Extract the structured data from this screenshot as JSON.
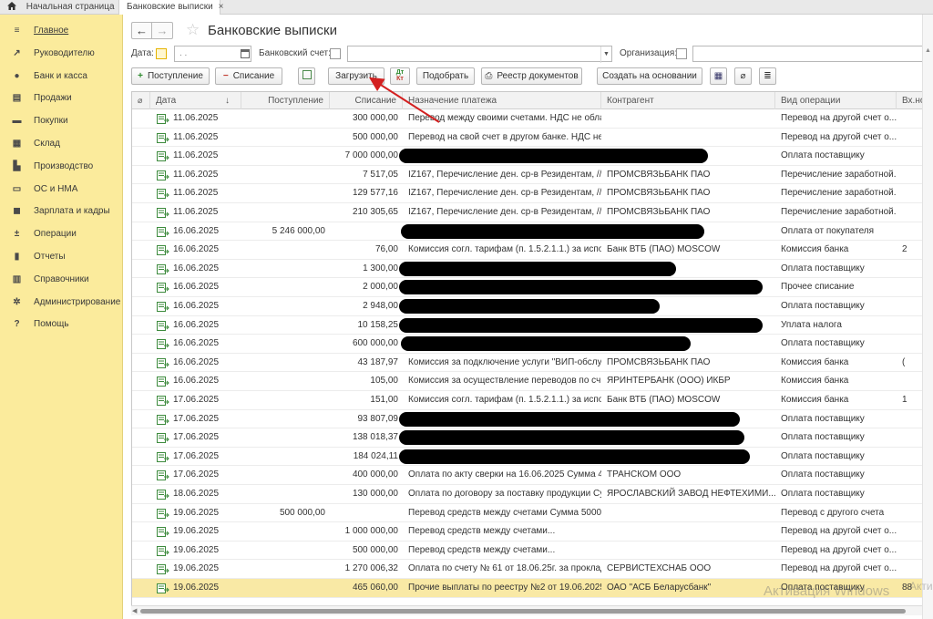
{
  "tabs": {
    "home": "Начальная страница",
    "active": "Банковские выписки",
    "close_glyph": "×"
  },
  "sidebar": {
    "items": [
      {
        "label": "Главное",
        "icon": "menu-icon"
      },
      {
        "label": "Руководителю",
        "icon": "trend-icon"
      },
      {
        "label": "Банк и касса",
        "icon": "coin-icon"
      },
      {
        "label": "Продажи",
        "icon": "cart-icon"
      },
      {
        "label": "Покупки",
        "icon": "basket-icon"
      },
      {
        "label": "Склад",
        "icon": "warehouse-icon"
      },
      {
        "label": "Производство",
        "icon": "factory-icon"
      },
      {
        "label": "ОС и НМА",
        "icon": "truck-icon"
      },
      {
        "label": "Зарплата и кадры",
        "icon": "person-icon"
      },
      {
        "label": "Операции",
        "icon": "dt-kt-icon"
      },
      {
        "label": "Отчеты",
        "icon": "chart-icon"
      },
      {
        "label": "Справочники",
        "icon": "book-icon"
      },
      {
        "label": "Администрирование",
        "icon": "gear-icon"
      },
      {
        "label": "Помощь",
        "icon": "help-icon"
      }
    ],
    "active_index": 0
  },
  "header": {
    "title": "Банковские выписки",
    "back_glyph": "←",
    "forward_glyph": "→",
    "star_glyph": "☆"
  },
  "filters": {
    "date_label": "Дата:",
    "date_placeholder": ". .",
    "bank_account_label": "Банковский счет:",
    "organization_label": "Организация:"
  },
  "toolbar": {
    "income": "Поступление",
    "expense": "Списание",
    "load": "Загрузить",
    "select": "Подобрать",
    "registry": "Реестр документов",
    "create_based": "Создать на основании",
    "dt": "Дт",
    "kt": "Кт"
  },
  "grid": {
    "columns": [
      "Дата",
      "Поступление",
      "Списание",
      "Назначение платежа",
      "Контрагент",
      "Вид операции",
      "Вх.номер"
    ],
    "sort_glyph": "↓",
    "rows": [
      {
        "date": "11.06.2025",
        "income": "",
        "expense": "300 000,00",
        "purpose": "Перевод между своими счетами. НДС не обла...",
        "counterparty": "",
        "operation": "Перевод на другой счет о...",
        "incoming": ""
      },
      {
        "date": "11.06.2025",
        "income": "",
        "expense": "500 000,00",
        "purpose": "Перевод на свой счет в другом банке. НДС не...",
        "counterparty": "",
        "operation": "Перевод на другой счет о...",
        "incoming": ""
      },
      {
        "date": "11.06.2025",
        "income": "",
        "expense": "7 000 000,00",
        "purpose": "",
        "counterparty": "",
        "operation": "Оплата поставщику",
        "incoming": "",
        "redacted": true
      },
      {
        "date": "11.06.2025",
        "income": "",
        "expense": "7 517,05",
        "purpose": "IZ167, Перечисление ден. ср-в Резидентам, //Р...",
        "counterparty": "ПРОМСВЯЗЬБАНК ПАО",
        "operation": "Перечисление заработной...",
        "incoming": ""
      },
      {
        "date": "11.06.2025",
        "income": "",
        "expense": "129 577,16",
        "purpose": "IZ167, Перечисление ден. ср-в Резидентам, //Р...",
        "counterparty": "ПРОМСВЯЗЬБАНК ПАО",
        "operation": "Перечисление заработной...",
        "incoming": ""
      },
      {
        "date": "11.06.2025",
        "income": "",
        "expense": "210 305,65",
        "purpose": "IZ167, Перечисление ден. ср-в Резидентам, //Р...",
        "counterparty": "ПРОМСВЯЗЬБАНК ПАО",
        "operation": "Перечисление заработной...",
        "incoming": ""
      },
      {
        "date": "16.06.2025",
        "income": "5 246 000,00",
        "expense": "",
        "purpose": "",
        "counterparty": "",
        "operation": "Оплата от покупателя",
        "incoming": "",
        "redacted": true
      },
      {
        "date": "16.06.2025",
        "income": "",
        "expense": "76,00",
        "purpose": "Комиссия согл. тарифам (п. 1.5.2.1.1.) за испо...",
        "counterparty": "Банк ВТБ (ПАО) MOSCOW",
        "operation": "Комиссия банка",
        "incoming": "2"
      },
      {
        "date": "16.06.2025",
        "income": "",
        "expense": "1 300,00",
        "purpose": "",
        "counterparty": "",
        "operation": "Оплата поставщику",
        "incoming": "",
        "redacted": true
      },
      {
        "date": "16.06.2025",
        "income": "",
        "expense": "2 000,00",
        "purpose": "",
        "counterparty": "",
        "operation": "Прочее списание",
        "incoming": "",
        "redacted": true
      },
      {
        "date": "16.06.2025",
        "income": "",
        "expense": "2 948,00",
        "purpose": "",
        "counterparty": "",
        "operation": "Оплата поставщику",
        "incoming": "",
        "redacted": true
      },
      {
        "date": "16.06.2025",
        "income": "",
        "expense": "10 158,25",
        "purpose": "",
        "counterparty": "",
        "operation": "Уплата налога",
        "incoming": "",
        "redacted": true
      },
      {
        "date": "16.06.2025",
        "income": "",
        "expense": "600 000,00",
        "purpose": "",
        "counterparty": "",
        "operation": "Оплата поставщику",
        "incoming": "",
        "redacted": true
      },
      {
        "date": "16.06.2025",
        "income": "",
        "expense": "43 187,97",
        "purpose": "Комиссия за подключение услуги \"ВИП-обслу...",
        "counterparty": "ПРОМСВЯЗЬБАНК ПАО",
        "operation": "Комиссия банка",
        "incoming": "("
      },
      {
        "date": "16.06.2025",
        "income": "",
        "expense": "105,00",
        "purpose": "Комиссия за осуществление переводов по сч...",
        "counterparty": "ЯРИНТЕРБАНК (ООО) ИКБР",
        "operation": "Комиссия банка",
        "incoming": ""
      },
      {
        "date": "17.06.2025",
        "income": "",
        "expense": "151,00",
        "purpose": "Комиссия согл. тарифам (п. 1.5.2.1.1.) за испо...",
        "counterparty": "Банк ВТБ (ПАО) MOSCOW",
        "operation": "Комиссия банка",
        "incoming": "1"
      },
      {
        "date": "17.06.2025",
        "income": "",
        "expense": "93 807,09",
        "purpose": "",
        "counterparty": "",
        "operation": "Оплата поставщику",
        "incoming": "",
        "redacted": true
      },
      {
        "date": "17.06.2025",
        "income": "",
        "expense": "138 018,37",
        "purpose": "",
        "counterparty": "",
        "operation": "Оплата поставщику",
        "incoming": "",
        "redacted": true
      },
      {
        "date": "17.06.2025",
        "income": "",
        "expense": "184 024,11",
        "purpose": "",
        "counterparty": "",
        "operation": "Оплата поставщику",
        "incoming": "",
        "redacted": true
      },
      {
        "date": "17.06.2025",
        "income": "",
        "expense": "400 000,00",
        "purpose": "Оплата по акту сверки на 16.06.2025 Сумма 4...",
        "counterparty": "ТРАНСКОМ ООО",
        "operation": "Оплата поставщику",
        "incoming": ""
      },
      {
        "date": "18.06.2025",
        "income": "",
        "expense": "130 000,00",
        "purpose": "Оплата по договору за поставку продукции Су...",
        "counterparty": "ЯРОСЛАВСКИЙ ЗАВОД НЕФТЕХИМИ...",
        "operation": "Оплата поставщику",
        "incoming": ""
      },
      {
        "date": "19.06.2025",
        "income": "500 000,00",
        "expense": "",
        "purpose": "Перевод средств между счетами Сумма 5000...",
        "counterparty": "",
        "operation": "Перевод с другого счета",
        "incoming": ""
      },
      {
        "date": "19.06.2025",
        "income": "",
        "expense": "1 000 000,00",
        "purpose": "Перевод средств между счетами...",
        "counterparty": "",
        "operation": "Перевод на другой счет о...",
        "incoming": ""
      },
      {
        "date": "19.06.2025",
        "income": "",
        "expense": "500 000,00",
        "purpose": "Перевод средств между счетами...",
        "counterparty": "",
        "operation": "Перевод на другой счет о...",
        "incoming": ""
      },
      {
        "date": "19.06.2025",
        "income": "",
        "expense": "1 270 006,32",
        "purpose": "Оплата по счету № 61 от 18.06.25г. за проклад...",
        "counterparty": "СЕРВИСТЕХСНАБ ООО",
        "operation": "Перевод на другой счет о...",
        "incoming": ""
      },
      {
        "date": "19.06.2025",
        "income": "",
        "expense": "465 060,00",
        "purpose": "Прочие выплаты по реестру №2 от 19.06.2025 ...",
        "counterparty": "ОАО \"АСБ Беларусбанк\"",
        "operation": "Оплата поставщику",
        "incoming": "88",
        "selected": true
      }
    ]
  },
  "watermark": {
    "line1": "Активация Windows",
    "line2": "Акти"
  },
  "colors": {
    "sidebar_bg": "#fbeb9c",
    "selected_row": "#f9e9a5",
    "annotation_arrow": "#d32020"
  }
}
